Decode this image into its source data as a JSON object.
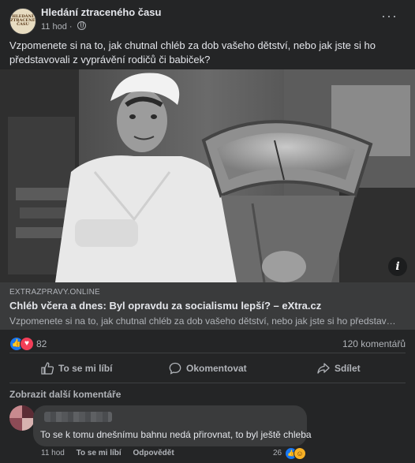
{
  "post": {
    "page_name": "Hledání ztraceného času",
    "avatar_text": "HLEDÁNÍ ZTRACENÉHO ČASU",
    "time": "11 hod",
    "text": "Vzpomenete si na to, jak chutnal chléb za dob vašeho dětství, nebo jak jste si ho představovali z vyprávění rodičů či babiček?",
    "more_icon": "ellipsis-icon"
  },
  "link_preview": {
    "domain": "EXTRAZPRAVY.ONLINE",
    "title": "Chléb včera a dnes: Byl opravdu za socialismu lepší? – eXtra.cz",
    "description": "Vzpomenete si na to, jak chutnal chléb za dob vašeho dětství, nebo jak jste si ho představovali z vyprávění rodičů či babiček?",
    "info_icon": "i"
  },
  "stats": {
    "reactions": "82",
    "comments": "120 komentářů"
  },
  "actions": {
    "like": "To se mi líbí",
    "comment": "Okomentovat",
    "share": "Sdílet"
  },
  "comments": {
    "more_label": "Zobrazit další komentáře",
    "items": [
      {
        "text": "To se k tomu dnešnímu bahnu nedá přirovnat, to byl ještě chleba",
        "time": "11 hod",
        "like_label": "To se mi líbí",
        "reply_label": "Odpovědět",
        "reaction_count": "26"
      }
    ]
  },
  "colors": {
    "background": "#242526",
    "card": "#3a3b3c",
    "text_primary": "#e4e6eb",
    "text_secondary": "#b0b3b8",
    "like_blue": "#1877f2",
    "love_red": "#f33e58"
  }
}
